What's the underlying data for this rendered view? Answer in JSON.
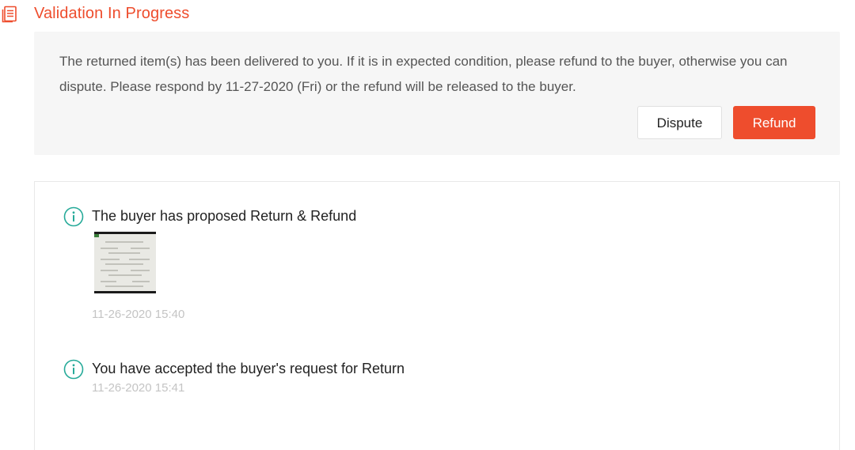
{
  "header": {
    "title": "Validation In Progress",
    "icon": "document-list-icon"
  },
  "notice": {
    "text": "The returned item(s) has been delivered to you. If it is in expected condition, please refund to the buyer, otherwise you can dispute. Please respond by 11-27-2020 (Fri) or the refund will be released to the buyer.",
    "dispute_label": "Dispute",
    "refund_label": "Refund"
  },
  "history": {
    "events": [
      {
        "icon": "info-icon",
        "title": "The buyer has proposed Return & Refund",
        "time": "11-26-2020 15:40",
        "has_attachment": true
      },
      {
        "icon": "info-icon",
        "title": "You have accepted the buyer's request for Return",
        "time": "11-26-2020 15:41",
        "has_attachment": false
      }
    ]
  },
  "colors": {
    "accent": "#ee4d2d",
    "info_icon": "#26aa99",
    "notice_bg": "#f6f6f6",
    "timestamp": "#c4c4c4"
  }
}
